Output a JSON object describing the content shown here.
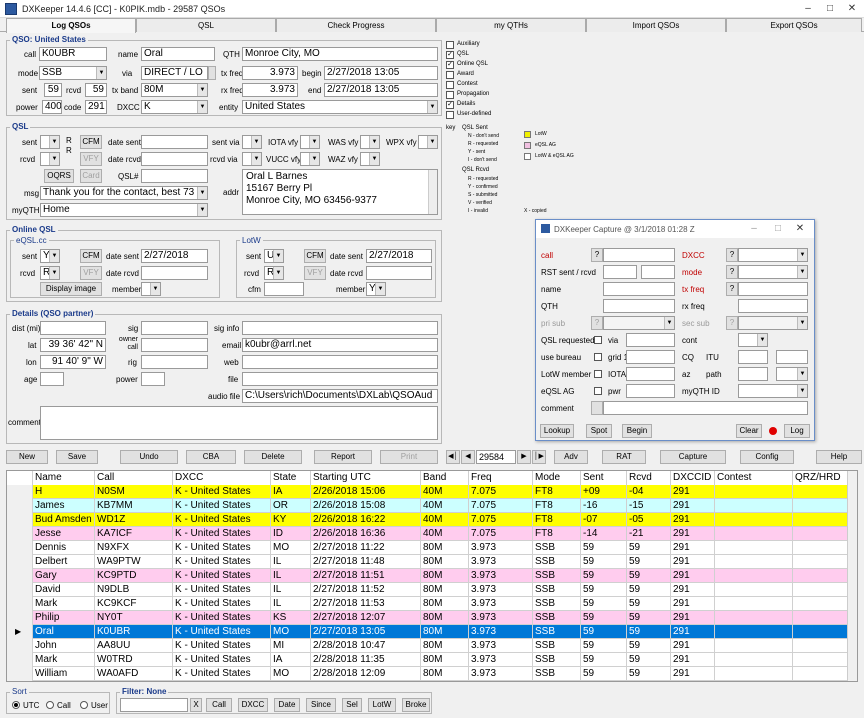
{
  "window": {
    "title": "DXKeeper 14.4.6 [CC] - K0PIK.mdb - 29587 QSOs"
  },
  "tabs": [
    "Log QSOs",
    "QSL",
    "Check Progress",
    "my QTHs",
    "Import QSOs",
    "Export QSOs"
  ],
  "qso": {
    "title": "QSO: United States",
    "call_label": "call",
    "call": "K0UBR",
    "name_label": "name",
    "name": "Oral",
    "qth_label": "QTH",
    "qth": "Monroe City, MO",
    "mode_label": "mode",
    "mode": "SSB",
    "via_label": "via",
    "via": "DIRECT / LO",
    "txfreq_label": "tx freq",
    "txfreq": "3.973",
    "begin_label": "begin",
    "begin": "2/27/2018  13:05",
    "sent_label": "sent",
    "sent": "59",
    "rcvd_label": "rcvd",
    "rcvd": "59",
    "txband_label": "tx band",
    "txband": "80M",
    "rxfreq_label": "rx freq",
    "rxfreq": "3.973",
    "end_label": "end",
    "end": "2/27/2018  13:05",
    "power_label": "power",
    "power": "400",
    "code_label": "code",
    "code": "291",
    "dxcc_label": "DXCC",
    "dxcc": "K",
    "entity_label": "entity",
    "entity": "United States"
  },
  "options": [
    {
      "label": "Auxiliary",
      "checked": false
    },
    {
      "label": "QSL",
      "checked": true
    },
    {
      "label": "Online QSL",
      "checked": true
    },
    {
      "label": "Award",
      "checked": false
    },
    {
      "label": "Contest",
      "checked": false
    },
    {
      "label": "Propagation",
      "checked": false
    },
    {
      "label": "Details",
      "checked": true
    },
    {
      "label": "User-defined",
      "checked": false
    }
  ],
  "key": {
    "label": "key",
    "qsl_sent_title": "QSL Sent",
    "qsl_sent": [
      "N - don't send",
      "R - requested",
      "Y - sent",
      "I - don't send"
    ],
    "qsl_rcvd_title": "QSL Rcvd",
    "qsl_rcvd": [
      "R - requested",
      "Y - confirmed",
      "S - submitted",
      "V - verified",
      "I - invalid"
    ],
    "x_copied": "X - copied",
    "legend": [
      {
        "label": "LotW",
        "color": "#f0f000"
      },
      {
        "label": "eQSL AG",
        "color": "#f0c0e0"
      },
      {
        "label": "LotW & eQSL AG",
        "color": "#ffffff"
      }
    ]
  },
  "qsl": {
    "title": "QSL",
    "sent_label": "sent",
    "rcvd_label": "rcvd",
    "r_label": "R",
    "cfm": "CFM",
    "vfy": "VFY",
    "date_sent_label": "date sent",
    "date_rcvd_label": "date rcvd",
    "sent_via_label": "sent via",
    "rcvd_via_label": "rcvd via",
    "iota_vfy": "IOTA vfy",
    "was_vfy": "WAS vfy",
    "wpx_vfy": "WPX vfy",
    "vucc_vfy": "VUCC vfy",
    "waz_vfy": "WAZ vfy",
    "oqrs": "OQRS",
    "card": "Card",
    "qsl_num_label": "QSL#",
    "msg_label": "msg",
    "msg": "Thank you for the contact, best 73",
    "myqth_label": "myQTH",
    "myqth": "Home",
    "addr_label": "addr",
    "addr": [
      "Oral L Barnes",
      "15167 Berry Pl",
      "Monroe City, MO 63456-9377"
    ]
  },
  "online_qsl": {
    "title": "Online QSL",
    "eqsl_title": "eQSL.cc",
    "eqsl_sent": "Y",
    "eqsl_rcvd": "R",
    "eqsl_date_sent": "2/27/2018",
    "display_image": "Display image",
    "member_label": "member",
    "lotw_title": "LotW",
    "lotw_sent": "U",
    "lotw_rcvd": "R",
    "lotw_date_sent": "2/27/2018",
    "cfm_label": "cfm",
    "lotw_member": "Y",
    "sent_label": "sent",
    "rcvd_label": "rcvd",
    "date_sent_label": "date sent",
    "date_rcvd_label": "date rcvd",
    "cfm": "CFM",
    "vfy": "VFY"
  },
  "details": {
    "title": "Details (QSO partner)",
    "dist_label": "dist (mi)",
    "sig_label": "sig",
    "sig_info_label": "sig info",
    "lat_label": "lat",
    "lat": "39 36' 42\" N",
    "owner_label": "owner call",
    "email_label": "email",
    "email": "k0ubr@arrl.net",
    "lon_label": "lon",
    "lon": "91 40' 9\" W",
    "rig_label": "rig",
    "web_label": "web",
    "age_label": "age",
    "power_label": "power",
    "file_label": "file",
    "audio_label": "audio file",
    "audio": "C:\\Users\\rich\\Documents\\DXLab\\QSOAud",
    "comment_label": "comment"
  },
  "capture": {
    "title": "DXKeeper Capture @ 3/1/2018  01:28 Z",
    "call": "call",
    "dxcc": "DXCC",
    "rst": "RST sent / rcvd",
    "mode": "mode",
    "name": "name",
    "txfreq": "tx freq",
    "qth": "QTH",
    "rxfreq": "rx freq",
    "prisub": "pri sub",
    "secsub": "sec sub",
    "qslreq": "QSL requested",
    "via": "via",
    "cont": "cont",
    "usebureau": "use bureau",
    "grid1": "grid 1",
    "cq": "CQ",
    "itu": "ITU",
    "lotwmember": "LotW member",
    "iota": "IOTA",
    "az": "az",
    "path": "path",
    "eqslag": "eQSL AG",
    "pwr": "pwr",
    "myqthid": "myQTH ID",
    "comment": "comment",
    "q": "?",
    "buttons": [
      "Lookup",
      "Spot",
      "Begin",
      "Clear",
      "Log"
    ]
  },
  "toolbar": {
    "new": "New",
    "save": "Save",
    "undo": "Undo",
    "cba": "CBA",
    "delete": "Delete",
    "report": "Report",
    "print": "Print",
    "count": "29584",
    "adv": "Adv",
    "rat": "RAT",
    "capture": "Capture",
    "config": "Config",
    "help": "Help"
  },
  "grid": {
    "columns": [
      "Name",
      "Call",
      "DXCC",
      "State",
      "Starting UTC",
      "Band",
      "Freq",
      "Mode",
      "Sent",
      "Rcvd",
      "DXCCID",
      "Contest",
      "QRZ/HRD"
    ],
    "rows": [
      {
        "bg": "#ffff00",
        "c": [
          "H",
          "N0SM",
          "K - United States",
          "IA",
          "2/26/2018  15:06",
          "40M",
          "7.075",
          "FT8",
          "+09",
          "-04",
          "291",
          "",
          ""
        ]
      },
      {
        "bg": "#ccffff",
        "c": [
          "James",
          "KB7MM",
          "K - United States",
          "OR",
          "2/26/2018  15:08",
          "40M",
          "7.075",
          "FT8",
          "-16",
          "-15",
          "291",
          "",
          ""
        ]
      },
      {
        "bg": "#ffff00",
        "c": [
          "Bud Amsden",
          "WD1Z",
          "K - United States",
          "KY",
          "2/26/2018  16:22",
          "40M",
          "7.075",
          "FT8",
          "-07",
          "-05",
          "291",
          "",
          ""
        ]
      },
      {
        "bg": "#ffccee",
        "c": [
          "Jesse",
          "KA7ICF",
          "K - United States",
          "ID",
          "2/26/2018  16:36",
          "40M",
          "7.075",
          "FT8",
          "-14",
          "-21",
          "291",
          "",
          ""
        ]
      },
      {
        "bg": "#ffffff",
        "c": [
          "Dennis",
          "N9XFX",
          "K - United States",
          "MO",
          "2/27/2018  11:22",
          "80M",
          "3.973",
          "SSB",
          "59",
          "59",
          "291",
          "",
          ""
        ]
      },
      {
        "bg": "#ffffff",
        "c": [
          "Delbert",
          "WA9PTW",
          "K - United States",
          "IL",
          "2/27/2018  11:48",
          "80M",
          "3.973",
          "SSB",
          "59",
          "59",
          "291",
          "",
          ""
        ]
      },
      {
        "bg": "#ffccee",
        "c": [
          "Gary",
          "KC9PTD",
          "K - United States",
          "IL",
          "2/27/2018  11:51",
          "80M",
          "3.973",
          "SSB",
          "59",
          "59",
          "291",
          "",
          ""
        ]
      },
      {
        "bg": "#ffffff",
        "c": [
          "David",
          "N9DLB",
          "K - United States",
          "IL",
          "2/27/2018  11:52",
          "80M",
          "3.973",
          "SSB",
          "59",
          "59",
          "291",
          "",
          ""
        ]
      },
      {
        "bg": "#ffffff",
        "c": [
          "Mark",
          "KC9KCF",
          "K - United States",
          "IL",
          "2/27/2018  11:53",
          "80M",
          "3.973",
          "SSB",
          "59",
          "59",
          "291",
          "",
          ""
        ]
      },
      {
        "bg": "#ffccee",
        "c": [
          "Philip",
          "NY0T",
          "K - United States",
          "KS",
          "2/27/2018  12:07",
          "80M",
          "3.973",
          "SSB",
          "59",
          "59",
          "291",
          "",
          ""
        ]
      },
      {
        "bg": "#0078d7",
        "c": [
          "Oral",
          "K0UBR",
          "K - United States",
          "MO",
          "2/27/2018  13:05",
          "80M",
          "3.973",
          "SSB",
          "59",
          "59",
          "291",
          "",
          ""
        ]
      },
      {
        "bg": "#ffffff",
        "c": [
          "John",
          "AA8UU",
          "K - United States",
          "MI",
          "2/28/2018  10:47",
          "80M",
          "3.973",
          "SSB",
          "59",
          "59",
          "291",
          "",
          ""
        ]
      },
      {
        "bg": "#ffffff",
        "c": [
          "Mark",
          "W0TRD",
          "K - United States",
          "IA",
          "2/28/2018  11:35",
          "80M",
          "3.973",
          "SSB",
          "59",
          "59",
          "291",
          "",
          ""
        ]
      },
      {
        "bg": "#ffffff",
        "c": [
          "William",
          "WA0AFD",
          "K - United States",
          "MO",
          "2/28/2018  12:09",
          "80M",
          "3.973",
          "SSB",
          "59",
          "59",
          "291",
          "",
          ""
        ]
      }
    ]
  },
  "bottom": {
    "sort_label": "Sort",
    "utc": "UTC",
    "call": "Call",
    "user": "User",
    "filter_label": "Filter: None",
    "x": "X",
    "buttons": [
      "Call",
      "DXCC",
      "Date",
      "Since",
      "Sel",
      "LotW",
      "Broke"
    ]
  }
}
